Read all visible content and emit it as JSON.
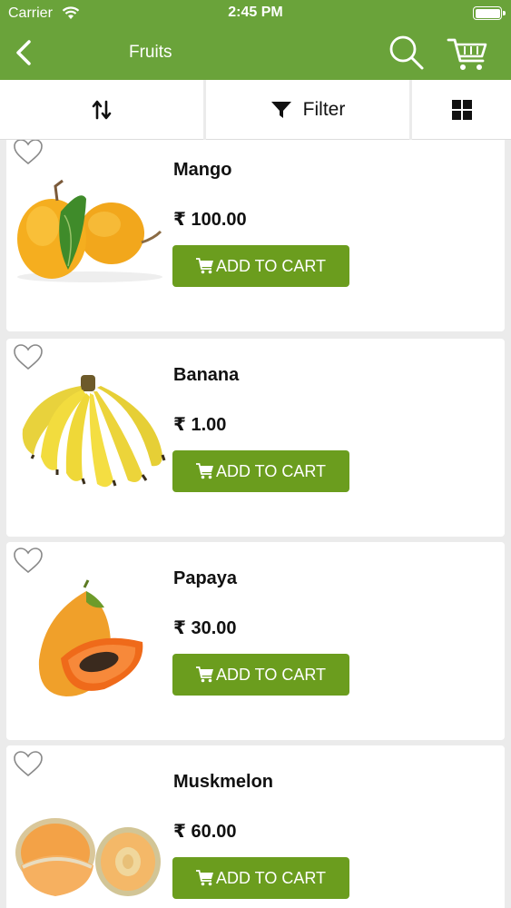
{
  "status_bar": {
    "carrier": "Carrier",
    "time": "2:45 PM"
  },
  "nav": {
    "title": "Fruits"
  },
  "toolbar": {
    "filter_label": "Filter"
  },
  "colors": {
    "brand_green": "#6aa33a",
    "button_green": "#6b9d1e",
    "background": "#ebebeb"
  },
  "products": [
    {
      "name": "Mango",
      "price": "₹ 100.00",
      "button": "ADD TO CART"
    },
    {
      "name": "Banana",
      "price": "₹ 1.00",
      "button": "ADD TO CART"
    },
    {
      "name": "Papaya",
      "price": "₹ 30.00",
      "button": "ADD TO CART"
    },
    {
      "name": "Muskmelon",
      "price": "₹ 60.00",
      "button": "ADD TO CART"
    }
  ]
}
